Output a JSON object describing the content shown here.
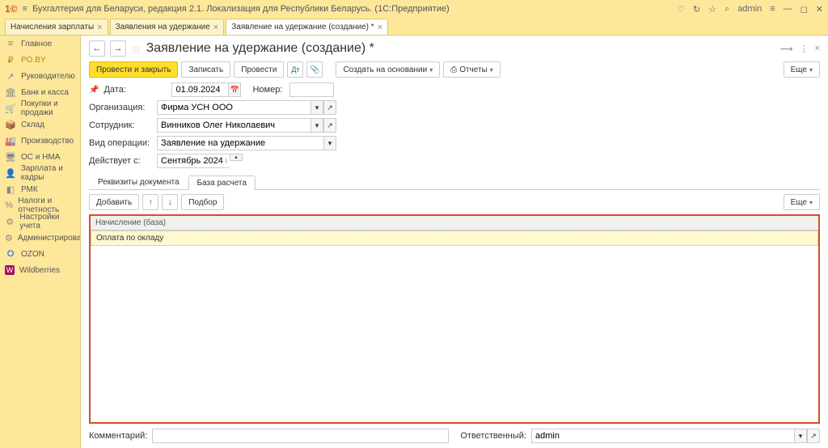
{
  "titlebar": {
    "logo": "1©",
    "app_title": "Бухгалтерия для Беларуси, редакция 2.1. Локализация для Республики Беларусь.  (1С:Предприятие)",
    "user": "admin"
  },
  "doc_tabs": [
    {
      "label": "Начисления зарплаты",
      "active": false
    },
    {
      "label": "Заявления на удержание",
      "active": false
    },
    {
      "label": "Заявление на удержание (создание) *",
      "active": true
    }
  ],
  "sidebar": {
    "items": [
      {
        "icon": "≡",
        "label": "Главное"
      },
      {
        "icon": "₽",
        "label": "PO.BY",
        "active": true
      },
      {
        "icon": "↗",
        "label": "Руководителю"
      },
      {
        "icon": "🏛",
        "label": "Банк и касса"
      },
      {
        "icon": "🛒",
        "label": "Покупки и продажи"
      },
      {
        "icon": "📦",
        "label": "Склад"
      },
      {
        "icon": "🏭",
        "label": "Производство"
      },
      {
        "icon": "🖥",
        "label": "ОС и НМА"
      },
      {
        "icon": "👤",
        "label": "Зарплата и кадры"
      },
      {
        "icon": "◧",
        "label": "РМК"
      },
      {
        "icon": "%",
        "label": "Налоги и отчетность"
      },
      {
        "icon": "⚙",
        "label": "Настройки учета"
      },
      {
        "icon": "⚙",
        "label": "Администрирование"
      },
      {
        "icon": "O",
        "label": "OZON"
      },
      {
        "icon": "W",
        "label": "Wildberries"
      }
    ]
  },
  "page": {
    "title": "Заявление на удержание (создание) *"
  },
  "toolbar": {
    "submit_close": "Провести и закрыть",
    "save": "Записать",
    "submit": "Провести",
    "create_based": "Создать на основании",
    "reports": "Отчеты",
    "more": "Еще"
  },
  "form": {
    "date_label": "Дата:",
    "date_value": "01.09.2024",
    "number_label": "Номер:",
    "number_value": "",
    "org_label": "Организация:",
    "org_value": "Фирма УСН ООО",
    "employee_label": "Сотрудник:",
    "employee_value": "Винников Олег Николаевич",
    "optype_label": "Вид операции:",
    "optype_value": "Заявление на удержание",
    "valid_label": "Действует с:",
    "valid_value": "Сентябрь 2024 г."
  },
  "subtabs": {
    "details": "Реквизиты документа",
    "base": "База расчета"
  },
  "subtoolbar": {
    "add": "Добавить",
    "pick": "Подбор",
    "more": "Еще"
  },
  "grid": {
    "header": "Начисление (база)",
    "rows": [
      {
        "value": "Оплата по окладу",
        "selected": true
      }
    ]
  },
  "footer": {
    "comment_label": "Комментарий:",
    "responsible_label": "Ответственный:",
    "responsible_value": "admin"
  }
}
